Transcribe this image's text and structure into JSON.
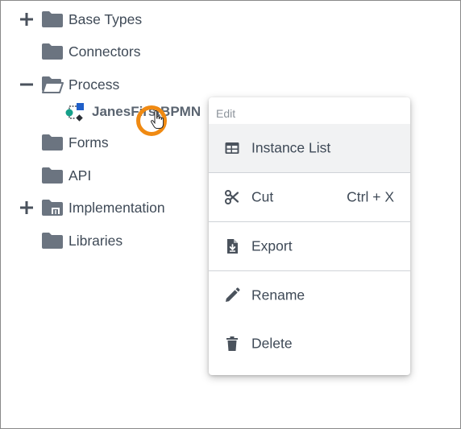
{
  "tree": {
    "items": [
      {
        "label": "Base Types",
        "expander": "plus-icon",
        "icon": "folder-icon"
      },
      {
        "label": "Connectors",
        "expander": null,
        "icon": "folder-icon"
      },
      {
        "label": "Process",
        "expander": "minus-icon",
        "icon": "folder-open-icon"
      },
      {
        "label": "Forms",
        "expander": null,
        "icon": "folder-icon"
      },
      {
        "label": "API",
        "expander": null,
        "icon": "folder-icon"
      },
      {
        "label": "Implementation",
        "expander": "plus-icon",
        "icon": "folder-package-icon"
      },
      {
        "label": "Libraries",
        "expander": null,
        "icon": "folder-icon"
      }
    ],
    "process_child": {
      "label": "JanesFirstBPMN",
      "icon": "bpmn-process-icon"
    }
  },
  "context_menu": {
    "header": "Edit",
    "items": [
      {
        "label": "Instance List",
        "icon": "table-icon",
        "shortcut": ""
      },
      {
        "label": "Cut",
        "icon": "scissors-icon",
        "shortcut": "Ctrl + X"
      },
      {
        "label": "Export",
        "icon": "file-export-icon",
        "shortcut": ""
      },
      {
        "label": "Rename",
        "icon": "pencil-icon",
        "shortcut": ""
      },
      {
        "label": "Delete",
        "icon": "trash-icon",
        "shortcut": ""
      }
    ]
  },
  "colors": {
    "text": "#3f4a57",
    "icon": "#6b7480",
    "highlight_ring": "#f08a12",
    "active_item_bg": "#f1f2f3",
    "bpmn_blue": "#1f5fc9",
    "bpmn_teal": "#16a08a"
  }
}
